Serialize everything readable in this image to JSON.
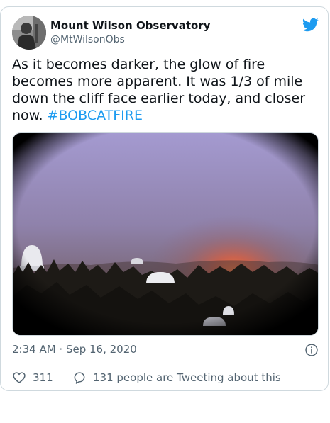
{
  "tweet": {
    "author": {
      "display_name": "Mount Wilson Observatory",
      "handle": "@MtWilsonObs"
    },
    "text": "As it becomes darker, the glow of fire becomes more apparent. It was 1/3 of mile down the cliff face earlier today, and closer now. ",
    "hashtag": "#BOBCATFIRE",
    "timestamp": "2:34 AM · Sep 16, 2020",
    "likes": "311",
    "replies_text": "131 people are Tweeting about this"
  },
  "colors": {
    "brand_blue": "#1d9bf0",
    "text_primary": "#0f1419",
    "text_secondary": "#536471",
    "border": "#cfd9de"
  },
  "icons": {
    "brand": "twitter-bird-icon",
    "info": "info-icon",
    "like": "heart-icon",
    "reply": "speech-bubble-icon"
  }
}
